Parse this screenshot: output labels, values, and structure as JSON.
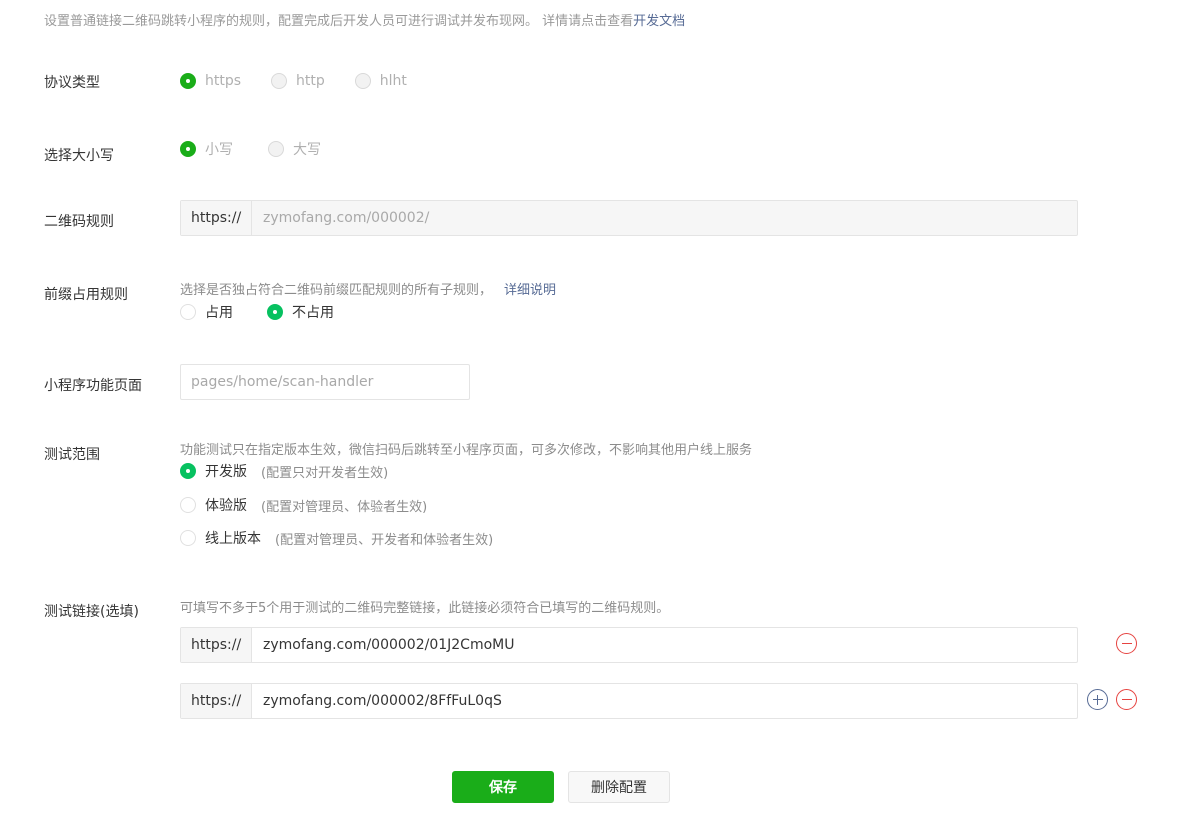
{
  "intro": {
    "text": "设置普通链接二维码跳转小程序的规则，配置完成后开发人员可进行调试并发布现网。 详情请点击查看",
    "link": "开发文档"
  },
  "protocol": {
    "label": "协议类型",
    "options": [
      "https",
      "http",
      "hlht"
    ],
    "selected": "https"
  },
  "case": {
    "label": "选择大小写",
    "options": [
      "小写",
      "大写"
    ],
    "selected": "小写"
  },
  "qr_rule": {
    "label": "二维码规则",
    "prefix": "https://",
    "value": "zymofang.com/000002/"
  },
  "prefix_rule": {
    "label": "前缀占用规则",
    "hint": "选择是否独占符合二维码前缀匹配规则的所有子规则，",
    "hint_link": "详细说明",
    "options": [
      "占用",
      "不占用"
    ],
    "selected": "不占用"
  },
  "page_path": {
    "label": "小程序功能页面",
    "placeholder": "pages/home/scan-handler"
  },
  "test_scope": {
    "label": "测试范围",
    "hint": "功能测试只在指定版本生效，微信扫码后跳转至小程序页面，可多次修改，不影响其他用户线上服务",
    "options": [
      {
        "label": "开发版",
        "note": "(配置只对开发者生效)"
      },
      {
        "label": "体验版",
        "note": "(配置对管理员、体验者生效)"
      },
      {
        "label": "线上版本",
        "note": "(配置对管理员、开发者和体验者生效)"
      }
    ],
    "selected": "开发版"
  },
  "test_links": {
    "label": "测试链接(选填)",
    "hint": "可填写不多于5个用于测试的二维码完整链接，此链接必须符合已填写的二维码规则。",
    "prefix": "https://",
    "links": [
      "zymofang.com/000002/01J2CmoMU",
      "zymofang.com/000002/8FfFuL0qS"
    ]
  },
  "actions": {
    "save": "保存",
    "delete": "删除配置"
  },
  "colors": {
    "primary_green": "#1aad19",
    "radio_green": "#07c160",
    "link_blue": "#576b95",
    "danger_red": "#e64340"
  }
}
